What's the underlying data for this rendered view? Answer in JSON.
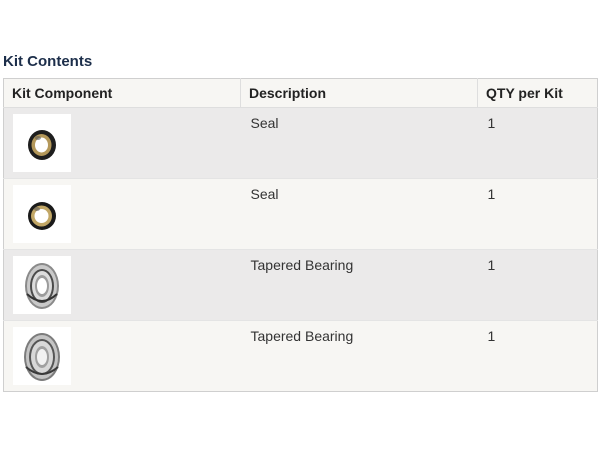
{
  "section": {
    "title": "Kit Contents"
  },
  "table": {
    "headers": [
      "Kit Component",
      "Description",
      "QTY per Kit"
    ],
    "rows": [
      {
        "image": "seal-icon",
        "description": "Seal",
        "qty": "1"
      },
      {
        "image": "seal-icon",
        "description": "Seal",
        "qty": "1"
      },
      {
        "image": "tapered-bearing-icon",
        "description": "Tapered Bearing",
        "qty": "1"
      },
      {
        "image": "tapered-bearing-icon",
        "description": "Tapered Bearing",
        "qty": "1"
      }
    ]
  }
}
